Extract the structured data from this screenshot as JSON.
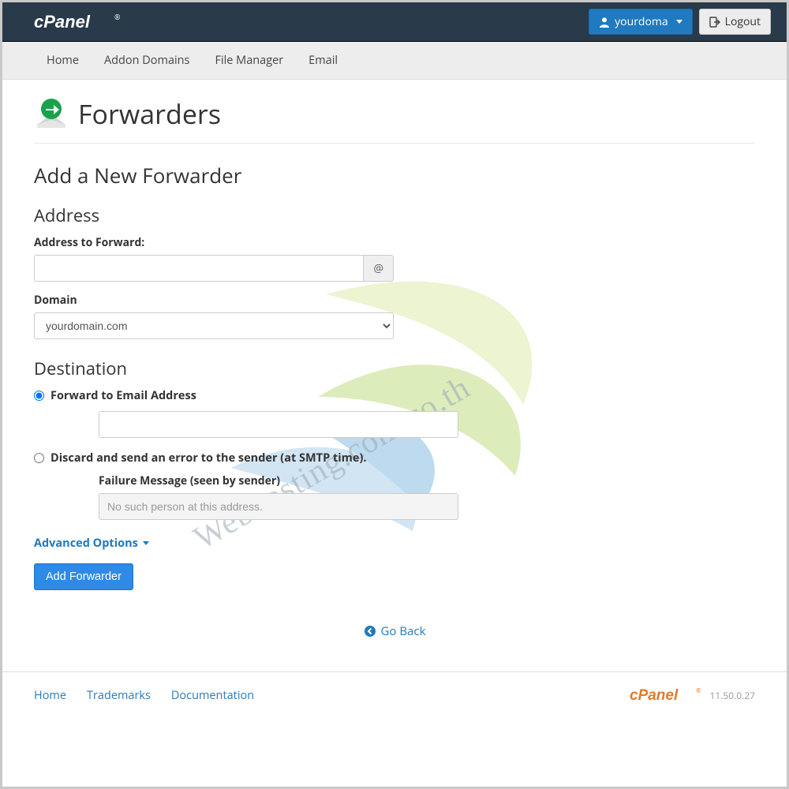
{
  "header": {
    "brand": "cPanel",
    "user_label": "yourdoma",
    "logout_label": "Logout"
  },
  "nav": {
    "items": [
      "Home",
      "Addon Domains",
      "File Manager",
      "Email"
    ]
  },
  "page": {
    "title": "Forwarders",
    "section_title": "Add a New Forwarder",
    "address_title": "Address",
    "address_to_forward_label": "Address to Forward:",
    "at_symbol": "@",
    "domain_label": "Domain",
    "domain_value": "yourdomain.com",
    "destination_title": "Destination",
    "forward_to_label": "Forward to Email Address",
    "discard_label": "Discard and send an error to the sender (at SMTP time).",
    "failure_msg_label": "Failure Message (seen by sender)",
    "failure_msg_value": "No such person at this address.",
    "advanced_options": "Advanced Options",
    "submit_label": "Add Forwarder",
    "go_back": "Go Back"
  },
  "footer": {
    "links": [
      "Home",
      "Trademarks",
      "Documentation"
    ],
    "brand": "cPanel",
    "version": "11.50.0.27"
  },
  "watermark": "Webhosting.com.co.th"
}
